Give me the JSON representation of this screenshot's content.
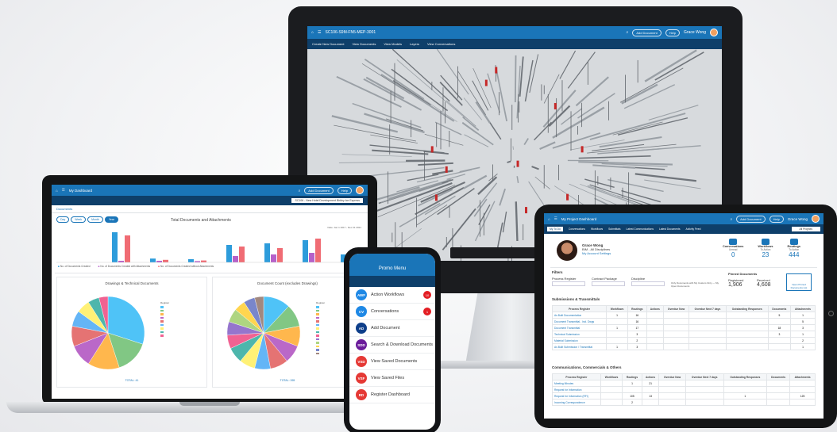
{
  "monitor": {
    "doc_title": "SC106-S9M-FN5-MEP-3001",
    "add_document": "Add Document",
    "help": "Help",
    "user_name": "Grace Wong",
    "user_sub": "BIM",
    "toolbar": [
      "Create New Document",
      "View Documents",
      "View Models",
      "Layers",
      "View Conversations"
    ]
  },
  "laptop": {
    "app_title": "My Dashboard",
    "project": "SC106 - New Hotel Development Birkby Ice Express",
    "tabs_label": "Documents",
    "chart_title": "Total Documents and Attachments",
    "date_range": "Date: Jan 1 2017 - Dec 31 2021",
    "filter_buttons": [
      "Day",
      "Week",
      "Month",
      "Year"
    ],
    "legend": [
      "No. of Documents Created",
      "No. of Documents Created with Attachments",
      "No. of Documents Created without Attachments"
    ],
    "pie1_title": "Drawings & Technical Documents",
    "pie2_title": "Document Count (excludes Drawings)",
    "pie1_total": "TOTAL: 41",
    "pie2_total": "TOTAL: 265",
    "legend_heading": "Register"
  },
  "phone": {
    "menu_title": "Promo Menu",
    "items": [
      {
        "abbr": "AWF",
        "label": "Action Workflows",
        "color": "#1e88e5",
        "badge": "10"
      },
      {
        "abbr": "CV",
        "label": "Conversations",
        "color": "#1e88e5",
        "badge": "1"
      },
      {
        "abbr": "AD",
        "label": "Add Document",
        "color": "#0e3f8a",
        "badge": ""
      },
      {
        "abbr": "SDD",
        "label": "Search & Download Documents",
        "color": "#6a1b9a",
        "badge": ""
      },
      {
        "abbr": "VSD",
        "label": "View Saved Documents",
        "color": "#e53935",
        "badge": ""
      },
      {
        "abbr": "VSF",
        "label": "View Saved Files",
        "color": "#e53935",
        "badge": ""
      },
      {
        "abbr": "RD",
        "label": "Register Dashboard",
        "color": "#e53935",
        "badge": ""
      }
    ]
  },
  "tablet": {
    "app_title": "My Project Dashboard",
    "add_document": "Add Document",
    "help": "Help",
    "user_name": "Grace Wong",
    "user_sub": "BIM",
    "tabs": [
      "My To Do",
      "Conversations",
      "Workflows",
      "Submittals",
      "Latest Communications",
      "Latest Documents",
      "Activity Feed"
    ],
    "project_select": "All Projects",
    "profile_name": "Grace Wong",
    "profile_role": "BIM - All Disciplines",
    "profile_link": "My Account Settings",
    "stats": [
      {
        "label": "Conversations",
        "sub": "Unread",
        "value": "0"
      },
      {
        "label": "Workflows",
        "sub": "To Action",
        "value": "23"
      },
      {
        "label": "Routings",
        "sub": "To Action",
        "value": "444"
      }
    ],
    "filters_title": "Filters",
    "filter_labels": [
      "Process Register",
      "Contract Package",
      "Discipline"
    ],
    "filter_note": "Only Documents with My Custom Only — My Open Documents",
    "pinned_title": "Pinned Documents",
    "pinned_registered": "1,906",
    "pinned_received": "4,608",
    "pinned_registered_label": "Registered",
    "pinned_received_label": "Received",
    "pinned_button": "Open Pinned Documents List",
    "sec1_title": "Submissions & Transmittals",
    "sec2_title": "Communications, Commercials & Others",
    "col_heads": [
      "Process Register",
      "Workflows",
      "Routings",
      "Actions",
      "Overdue Now",
      "Overdue Next 7 days",
      "Outstanding Responses",
      "Documents",
      "Attachments"
    ],
    "sec1_rows": [
      {
        "name": "As Built Documentation",
        "v": [
          "1",
          "16",
          "",
          "",
          "",
          "",
          "5",
          "1"
        ]
      },
      {
        "name": "Document Transmittal - Incl. Dwgs",
        "v": [
          "",
          "16",
          "",
          "",
          "",
          "",
          "",
          "5"
        ]
      },
      {
        "name": "Document Transmittal",
        "v": [
          "1",
          "17",
          "",
          "",
          "",
          "",
          "18",
          "3"
        ]
      },
      {
        "name": "Technical Submission",
        "v": [
          "",
          "3",
          "",
          "",
          "",
          "",
          "3",
          "1"
        ]
      },
      {
        "name": "Material Submission",
        "v": [
          "",
          "2",
          "",
          "",
          "",
          "",
          "",
          "2"
        ]
      },
      {
        "name": "As Built Submission / Transmittal",
        "v": [
          "1",
          "3",
          "",
          "",
          "",
          "",
          "",
          "1"
        ]
      }
    ],
    "sec2_rows": [
      {
        "name": "Meeting Minutes",
        "v": [
          "",
          "1",
          "21",
          "",
          "",
          "",
          "",
          ""
        ]
      },
      {
        "name": "Request for Information",
        "v": [
          "",
          "",
          "",
          "",
          "",
          "",
          "",
          ""
        ]
      },
      {
        "name": "Request for Information (RFI)",
        "v": [
          "",
          "105",
          "13",
          "",
          "",
          "1",
          "",
          "125"
        ]
      },
      {
        "name": "Incoming Correspondence",
        "v": [
          "",
          "2",
          "",
          "",
          "",
          "",
          "",
          ""
        ]
      }
    ]
  }
}
